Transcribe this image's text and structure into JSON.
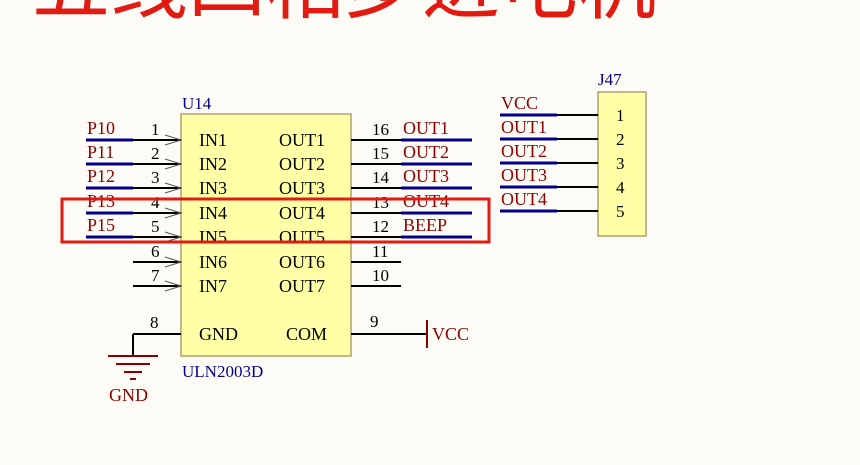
{
  "header": {
    "title_partial": "五线四相步进电机"
  },
  "colors": {
    "background": "#fdfbf5",
    "chip_fill": "#ffffa8",
    "chip_stroke": "#b3a06a",
    "wire": "#000000",
    "net_label": "#8b0000",
    "net_underline": "#00008b",
    "designator": "#00008b",
    "highlight": "#e21b12"
  },
  "u14": {
    "designator": "U14",
    "part": "ULN2003D",
    "inputs": [
      {
        "pin": "1",
        "name": "IN1",
        "net": "P10"
      },
      {
        "pin": "2",
        "name": "IN2",
        "net": "P11"
      },
      {
        "pin": "3",
        "name": "IN3",
        "net": "P12"
      },
      {
        "pin": "4",
        "name": "IN4",
        "net": "P13"
      },
      {
        "pin": "5",
        "name": "IN5",
        "net": "P15"
      },
      {
        "pin": "6",
        "name": "IN6",
        "net": ""
      },
      {
        "pin": "7",
        "name": "IN7",
        "net": ""
      }
    ],
    "outputs": [
      {
        "pin": "16",
        "name": "OUT1",
        "net": "OUT1"
      },
      {
        "pin": "15",
        "name": "OUT2",
        "net": "OUT2"
      },
      {
        "pin": "14",
        "name": "OUT3",
        "net": "OUT3"
      },
      {
        "pin": "13",
        "name": "OUT4",
        "net": "OUT4"
      },
      {
        "pin": "12",
        "name": "OUT5",
        "net": "BEEP"
      },
      {
        "pin": "11",
        "name": "OUT6",
        "net": ""
      },
      {
        "pin": "10",
        "name": "OUT7",
        "net": ""
      }
    ],
    "gnd": {
      "pin": "8",
      "name": "GND"
    },
    "com": {
      "pin": "9",
      "name": "COM"
    }
  },
  "power": {
    "gnd_label": "GND",
    "vcc_label": "VCC"
  },
  "j47": {
    "designator": "J47",
    "pins": [
      {
        "pin": "1",
        "net": "VCC"
      },
      {
        "pin": "2",
        "net": "OUT1"
      },
      {
        "pin": "3",
        "net": "OUT2"
      },
      {
        "pin": "4",
        "net": "OUT3"
      },
      {
        "pin": "5",
        "net": "OUT4"
      }
    ]
  }
}
